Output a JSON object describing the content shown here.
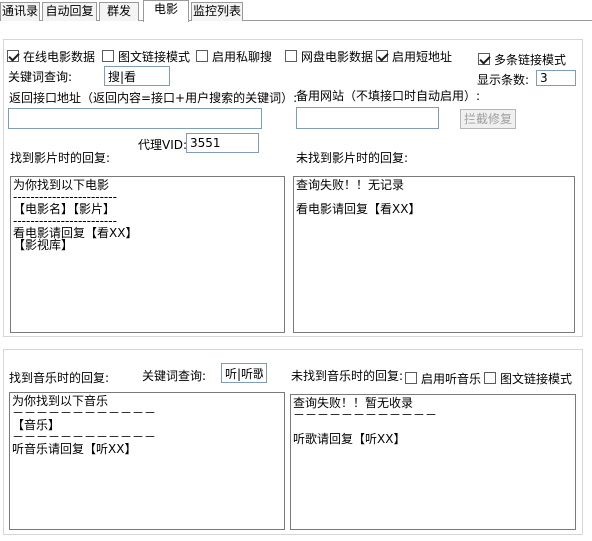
{
  "tabs": [
    {
      "label": "通讯录"
    },
    {
      "label": "自动回复"
    },
    {
      "label": "群发"
    },
    {
      "label": "电影"
    },
    {
      "label": "监控列表"
    }
  ],
  "movie": {
    "online_db": "在线电影数据",
    "image_link_mode": "图文链接模式",
    "enable_private_search": "启用私聊搜",
    "netdisk_db": "网盘电影数据",
    "enable_short_url": "启用短地址",
    "multi_link_mode": "多条链接模式",
    "keyword_label": "关键词查询:",
    "keyword_value": "搜|看",
    "display_count_label": "显示条数:",
    "display_count_value": "3",
    "api_url_label": "返回接口地址（返回内容=接口+用户搜索的关键词）:",
    "api_url_value": "",
    "backup_site_label": "备用网站（不填接口时自动启用）:",
    "backup_site_value": "",
    "fix_button": "拦截修复",
    "proxy_label": "代理VID:",
    "proxy_value": "3551",
    "found_label": "找到影片时的回复:",
    "notfound_label": "未找到影片时的回复:",
    "found_reply": [
      "为你找到以下电影",
      "------------------------",
      "【电影名】【影片】",
      "------------------------",
      "看电影请回复【看XX】",
      "【影视库】"
    ],
    "notfound_reply": [
      "查询失败！！无记录",
      "",
      "看电影请回复【看XX】"
    ]
  },
  "music": {
    "found_label": "找到音乐时的回复:",
    "keyword_label": "关键词查询:",
    "keyword_value": "听|听歌",
    "notfound_label": "未找到音乐时的回复:",
    "enable_music": "启用听音乐",
    "image_link_mode": "图文链接模式",
    "found_reply": [
      "为你找到以下音乐",
      "－－－－－－－－－－－－",
      "【音乐】",
      "－－－－－－－－－－－－",
      "听音乐请回复【听XX】"
    ],
    "notfound_reply": [
      "查询失败！！暂无收录",
      "－－－－－－－－－－－－",
      "",
      "听歌请回复【听XX】"
    ]
  },
  "checkbox_states": {
    "online_db": true,
    "image_link_mode": false,
    "enable_private_search": false,
    "netdisk_db": false,
    "enable_short_url": true,
    "multi_link_mode": true,
    "enable_music": false,
    "music_image_link_mode": false
  },
  "active_tab": "电影"
}
